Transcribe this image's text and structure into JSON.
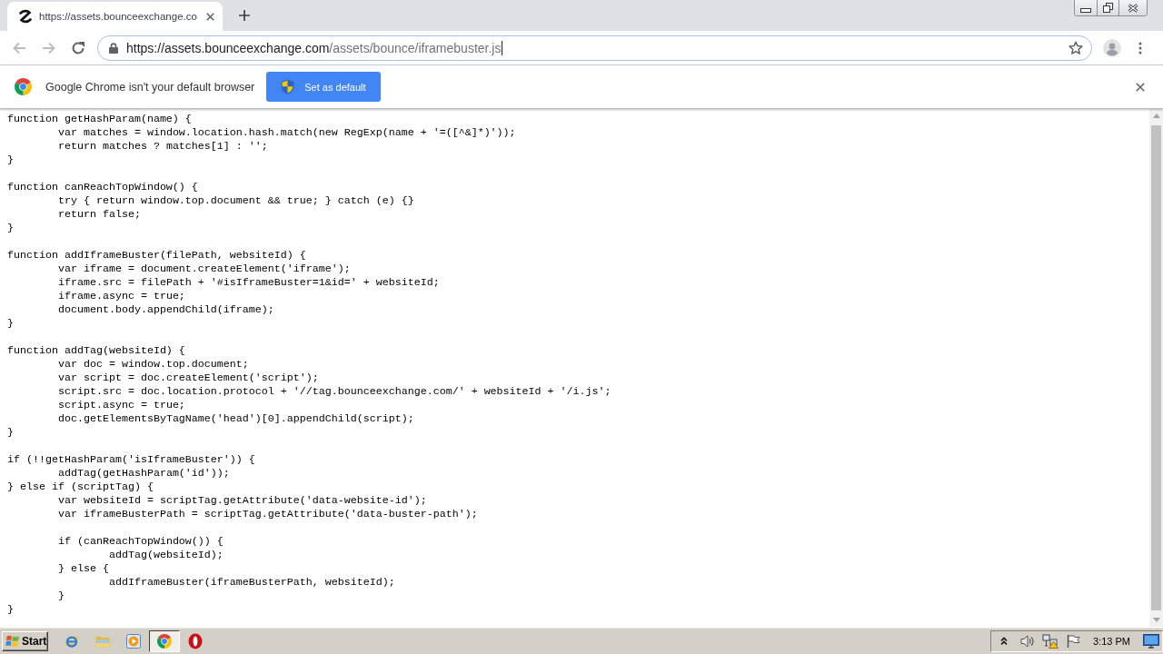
{
  "browser": {
    "tabs": [
      {
        "title": "https://assets.bounceexchange.co",
        "selected": true
      }
    ],
    "toolbar": {
      "back": {
        "disabled": true
      },
      "forward": {
        "disabled": true
      },
      "address": {
        "host": "https://assets.bounceexchange.com",
        "path": "/assets/bounce/iframebuster.js"
      }
    },
    "infobar": {
      "message": "Google Chrome isn't your default browser",
      "button": "Set as default"
    }
  },
  "document": {
    "code_blocks": [
      "function getHashParam(name) {\n\tvar matches = window.location.hash.match(new RegExp(name + '=([^&]*)'));\n\treturn matches ? matches[1] : '';\n}",
      "function canReachTopWindow() {\n\ttry { return window.top.document && true; } catch (e) {}\n\treturn false;\n}",
      "function addIframeBuster(filePath, websiteId) {\n\tvar iframe = document.createElement('iframe');\n\tiframe.src = filePath + '#isIframeBuster=1&id=' + websiteId;\n\tiframe.async = true;\n\tdocument.body.appendChild(iframe);\n}",
      "function addTag(websiteId) {\n\tvar doc = window.top.document;\n\tvar script = doc.createElement('script');\n\tscript.src = doc.location.protocol + '//tag.bounceexchange.com/' + websiteId + '/i.js';\n\tscript.async = true;\n\tdoc.getElementsByTagName('head')[0].appendChild(script);\n}",
      "if (!!getHashParam('isIframeBuster')) {\n\taddTag(getHashParam('id'));\n} else if (scriptTag) {\n\tvar websiteId = scriptTag.getAttribute('data-website-id');\n\tvar iframeBusterPath = scriptTag.getAttribute('data-buster-path');",
      "\tif (canReachTopWindow()) {\n\t\taddTag(websiteId);\n\t} else {\n\t\taddIframeBuster(iframeBusterPath, websiteId);\n\t}\n}"
    ]
  },
  "taskbar": {
    "start": "Start",
    "apps": [
      {
        "kind": "globe",
        "selected": false
      },
      {
        "kind": "folder",
        "selected": false
      },
      {
        "kind": "player",
        "selected": false
      },
      {
        "kind": "wheel",
        "selected": true
      },
      {
        "kind": "ring",
        "selected": false
      }
    ],
    "clock": "3:13 PM"
  }
}
